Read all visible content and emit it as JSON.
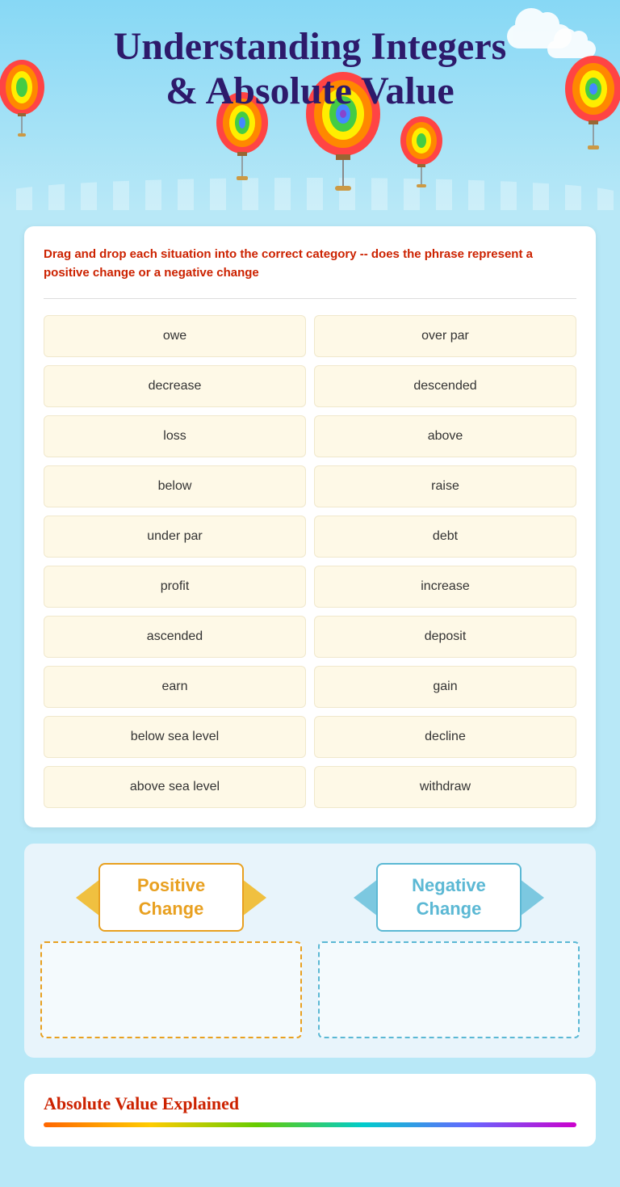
{
  "header": {
    "title_line1": "Understanding Integers",
    "title_line2": "& Absolute Value"
  },
  "instruction": {
    "text": "Drag and drop each situation into the correct category -- does the phrase represent a positive change or a negative change"
  },
  "word_tiles": [
    {
      "id": "owe",
      "label": "owe"
    },
    {
      "id": "over_par",
      "label": "over par"
    },
    {
      "id": "decrease",
      "label": "decrease"
    },
    {
      "id": "descended",
      "label": "descended"
    },
    {
      "id": "loss",
      "label": "loss"
    },
    {
      "id": "above",
      "label": "above"
    },
    {
      "id": "below",
      "label": "below"
    },
    {
      "id": "raise",
      "label": "raise"
    },
    {
      "id": "under_par",
      "label": "under par"
    },
    {
      "id": "debt",
      "label": "debt"
    },
    {
      "id": "profit",
      "label": "profit"
    },
    {
      "id": "increase",
      "label": "increase"
    },
    {
      "id": "ascended",
      "label": "ascended"
    },
    {
      "id": "deposit",
      "label": "deposit"
    },
    {
      "id": "earn",
      "label": "earn"
    },
    {
      "id": "gain",
      "label": "gain"
    },
    {
      "id": "below_sea_level",
      "label": "below sea level"
    },
    {
      "id": "decline",
      "label": "decline"
    },
    {
      "id": "above_sea_level",
      "label": "above sea level"
    },
    {
      "id": "withdraw",
      "label": "withdraw"
    }
  ],
  "drop_zones": {
    "positive": {
      "label": "Positive\nChange",
      "label_display": "Positive Change"
    },
    "negative": {
      "label": "Negative\nChange",
      "label_display": "Negative Change"
    }
  },
  "absolute_value_section": {
    "title": "Absolute Value Explained"
  }
}
